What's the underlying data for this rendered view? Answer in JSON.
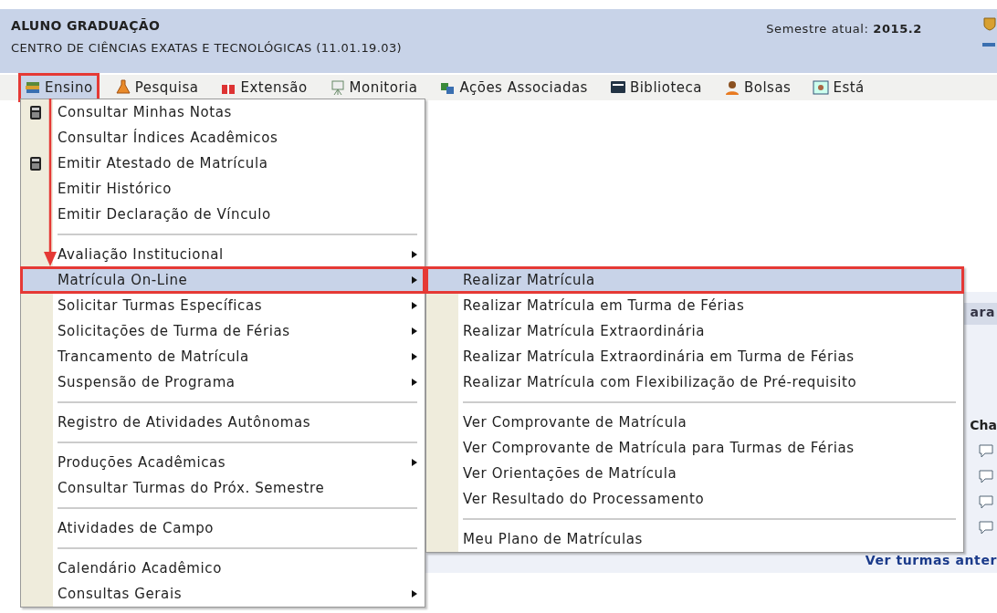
{
  "header": {
    "user": "ALUNO GRADUAÇÃO",
    "unit": "CENTRO DE CIÊNCIAS EXATAS E TECNOLÓGICAS (11.01.19.03)",
    "semester_label": "Semestre atual:",
    "semester": "2015.2"
  },
  "menu_bar": [
    {
      "label": "Ensino",
      "selected": true,
      "highlighted": true
    },
    {
      "label": "Pesquisa",
      "selected": false,
      "highlighted": false
    },
    {
      "label": "Extensão",
      "selected": false,
      "highlighted": false
    },
    {
      "label": "Monitoria",
      "selected": false,
      "highlighted": false
    },
    {
      "label": "Ações Associadas",
      "selected": false,
      "highlighted": false
    },
    {
      "label": "Biblioteca",
      "selected": false,
      "highlighted": false
    },
    {
      "label": "Bolsas",
      "selected": false,
      "highlighted": false
    },
    {
      "label": "Está",
      "selected": false,
      "highlighted": false
    }
  ],
  "dropdown": [
    {
      "kind": "item",
      "label": "Consultar Minhas Notas",
      "icon": true,
      "submenu": false,
      "selected": false,
      "highlighted": false
    },
    {
      "kind": "item",
      "label": "Consultar Índices Acadêmicos",
      "icon": false,
      "submenu": false,
      "selected": false,
      "highlighted": false
    },
    {
      "kind": "item",
      "label": "Emitir Atestado de Matrícula",
      "icon": true,
      "submenu": false,
      "selected": false,
      "highlighted": false
    },
    {
      "kind": "item",
      "label": "Emitir Histórico",
      "icon": false,
      "submenu": false,
      "selected": false,
      "highlighted": false
    },
    {
      "kind": "item",
      "label": "Emitir Declaração de Vínculo",
      "icon": false,
      "submenu": false,
      "selected": false,
      "highlighted": false
    },
    {
      "kind": "separator"
    },
    {
      "kind": "item",
      "label": "Avaliação Institucional",
      "icon": false,
      "submenu": true,
      "selected": false,
      "highlighted": false
    },
    {
      "kind": "item",
      "label": "Matrícula On-Line",
      "icon": false,
      "submenu": true,
      "selected": true,
      "highlighted": true
    },
    {
      "kind": "item",
      "label": "Solicitar Turmas Específicas",
      "icon": false,
      "submenu": true,
      "selected": false,
      "highlighted": false
    },
    {
      "kind": "item",
      "label": "Solicitações de Turma de Férias",
      "icon": false,
      "submenu": true,
      "selected": false,
      "highlighted": false
    },
    {
      "kind": "item",
      "label": "Trancamento de Matrícula",
      "icon": false,
      "submenu": true,
      "selected": false,
      "highlighted": false
    },
    {
      "kind": "item",
      "label": "Suspensão de Programa",
      "icon": false,
      "submenu": true,
      "selected": false,
      "highlighted": false
    },
    {
      "kind": "separator"
    },
    {
      "kind": "item",
      "label": "Registro de Atividades Autônomas",
      "icon": false,
      "submenu": false,
      "selected": false,
      "highlighted": false
    },
    {
      "kind": "separator"
    },
    {
      "kind": "item",
      "label": "Produções Acadêmicas",
      "icon": false,
      "submenu": true,
      "selected": false,
      "highlighted": false
    },
    {
      "kind": "item",
      "label": "Consultar Turmas do Próx. Semestre",
      "icon": false,
      "submenu": false,
      "selected": false,
      "highlighted": false
    },
    {
      "kind": "separator"
    },
    {
      "kind": "item",
      "label": "Atividades de Campo",
      "icon": false,
      "submenu": false,
      "selected": false,
      "highlighted": false
    },
    {
      "kind": "separator"
    },
    {
      "kind": "item",
      "label": "Calendário Acadêmico",
      "icon": false,
      "submenu": false,
      "selected": false,
      "highlighted": false
    },
    {
      "kind": "item",
      "label": "Consultas Gerais",
      "icon": false,
      "submenu": true,
      "selected": false,
      "highlighted": false
    }
  ],
  "submenu": [
    {
      "kind": "item",
      "label": "Realizar Matrícula",
      "selected": true,
      "highlighted": true
    },
    {
      "kind": "item",
      "label": "Realizar Matrícula em Turma de Férias",
      "selected": false,
      "highlighted": false
    },
    {
      "kind": "item",
      "label": "Realizar Matrícula Extraordinária",
      "selected": false,
      "highlighted": false
    },
    {
      "kind": "item",
      "label": "Realizar Matrícula Extraordinária em Turma de Férias",
      "selected": false,
      "highlighted": false
    },
    {
      "kind": "item",
      "label": "Realizar Matrícula com Flexibilização de Pré-requisito",
      "selected": false,
      "highlighted": false
    },
    {
      "kind": "separator"
    },
    {
      "kind": "item",
      "label": "Ver Comprovante de Matrícula",
      "selected": false,
      "highlighted": false
    },
    {
      "kind": "item",
      "label": "Ver Comprovante de Matrícula para Turmas de Férias",
      "selected": false,
      "highlighted": false
    },
    {
      "kind": "item",
      "label": "Ver Orientações de Matrícula",
      "selected": false,
      "highlighted": false
    },
    {
      "kind": "item",
      "label": "Ver Resultado do Processamento",
      "selected": false,
      "highlighted": false
    },
    {
      "kind": "separator"
    },
    {
      "kind": "item",
      "label": "Meu Plano de Matrículas",
      "selected": false,
      "highlighted": false
    }
  ],
  "background": {
    "tab_fragment": "ara",
    "heading_fragment": "Cha",
    "link": "Ver turmas anter"
  }
}
